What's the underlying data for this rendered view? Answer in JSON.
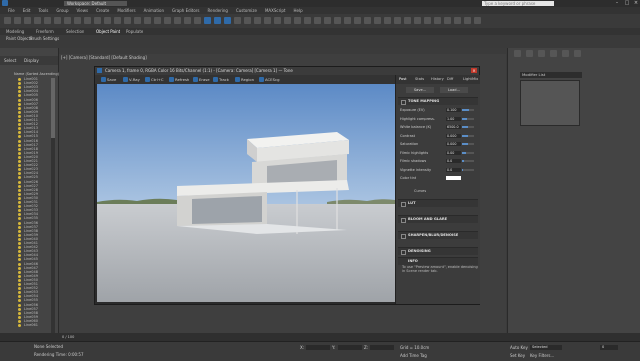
{
  "app": {
    "workspace": "Workspace: Default",
    "search_placeholder": "Type a keyword or phrase",
    "menus": [
      "File",
      "Edit",
      "Tools",
      "Group",
      "Views",
      "Create",
      "Modifiers",
      "Animation",
      "Graph Editors",
      "Rendering",
      "Customize",
      "MAXScript",
      "Help"
    ]
  },
  "ribbon": {
    "tabs": [
      "Modeling",
      "Freeform",
      "Selection",
      "Object Paint",
      "Populate"
    ],
    "sub": [
      "Paint Objects",
      "Brush Settings"
    ]
  },
  "scene_explorer": {
    "tabs": [
      "Select",
      "Display"
    ],
    "header": "Name (Sorted Ascending)",
    "items": [
      "Line001",
      "Line002",
      "Line003",
      "Line004",
      "Line005",
      "Line006",
      "Line007",
      "Line008",
      "Line009",
      "Line010",
      "Line011",
      "Line012",
      "Line013",
      "Line014",
      "Line015",
      "Line016",
      "Line017",
      "Line018",
      "Line019",
      "Line020",
      "Line021",
      "Line022",
      "Line023",
      "Line024",
      "Line025",
      "Line026",
      "Line027",
      "Line028",
      "Line029",
      "Line030",
      "Line031",
      "Line032",
      "Line033",
      "Line034",
      "Line035",
      "Line036",
      "Line037",
      "Line038",
      "Line039",
      "Line040",
      "Line041",
      "Line042",
      "Line043",
      "Line044",
      "Line045",
      "Line046",
      "Line047",
      "Line048",
      "Line049",
      "Line050",
      "Line051",
      "Line052",
      "Line053",
      "Line054",
      "Line055",
      "Line056",
      "Line057",
      "Line058",
      "Line059",
      "Line060",
      "Line061"
    ]
  },
  "viewport": {
    "label": "[+] [Camera] [Standard] [Default Shading]"
  },
  "vfb": {
    "title": "Camera 1, frame 0, RGBA Color 16 Bits/Channel (1:1) - [Camera: Camera] [Camera 1] — Tone",
    "toolbar": [
      "Save",
      "V-Ray",
      "Ctrl+C",
      "Refresh",
      "Erase",
      "Track",
      "Region",
      "ACEScg"
    ]
  },
  "corrections": {
    "tabs": [
      "Post",
      "Stats",
      "History",
      "Diff",
      "LightMix"
    ],
    "buttons": [
      "Save...",
      "Load..."
    ],
    "tone_mapping": "TONE MAPPING",
    "params": [
      {
        "label": "Exposure (EV)",
        "value": "0.100",
        "level": 0.55
      },
      {
        "label": "Highlight compress.",
        "value": "1.00",
        "level": 0.4
      },
      {
        "label": "White balance (K)",
        "value": "6500.0",
        "level": 0.5
      },
      {
        "label": "Contrast",
        "value": "0.000",
        "level": 0.5
      },
      {
        "label": "Saturation",
        "value": "0.000",
        "level": 0.5
      },
      {
        "label": "Filmic highlights",
        "value": "0.00",
        "level": 0.3
      },
      {
        "label": "Filmic shadows",
        "value": "0.0",
        "level": 0.2
      },
      {
        "label": "Vignette intensity",
        "value": "0.0",
        "level": 0.1
      },
      {
        "label": "Color tint",
        "value": "",
        "level": 0
      }
    ],
    "curves": "Curves",
    "sections": [
      "LUT",
      "BLOOM AND GLARE",
      "SHARPEN/BLUR/DENOISE",
      "DENOISING",
      "INFO"
    ],
    "info_text": "To use \"Preview amount\", enable denoising in Scene render tab."
  },
  "command_panel": {
    "modifier_list": "Modifier List"
  },
  "timeline": {
    "range": "0 / 100"
  },
  "status": {
    "left": "None Selected",
    "hint": "Rendering Time: 0:00:57",
    "x_label": "X:",
    "y_label": "Y:",
    "z_label": "Z:",
    "grid": "Grid = 10.0cm",
    "add_tag": "Add Time Tag",
    "key_mode": "Selected",
    "auto_key": "Auto Key",
    "set_key": "Set Key",
    "key_filters": "Key Filters...",
    "frame": "0"
  },
  "colors": {
    "accent": "#2f6aa8",
    "scene_eye": "#d6b83b",
    "close": "#c0392b"
  }
}
